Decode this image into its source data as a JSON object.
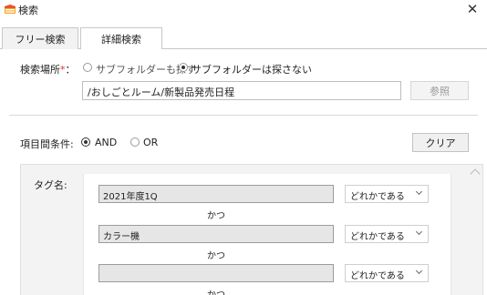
{
  "window": {
    "title": "検索",
    "close_glyph": "✕"
  },
  "tabs": [
    {
      "label": "フリー検索"
    },
    {
      "label": "詳細検索"
    }
  ],
  "search_location": {
    "label": "検索場所",
    "required_mark": "*",
    "colon": "：",
    "option_include": "サブフォルダーも探す",
    "option_exclude": "サブフォルダーは探さない",
    "selected": "exclude",
    "path_value": "/おしごとルーム/新製品発売日程",
    "browse_label": "参照"
  },
  "condition": {
    "label": "項目間条件:",
    "option_and": "AND",
    "option_or": "OR",
    "selected": "AND",
    "clear_label": "クリア"
  },
  "tags": {
    "label": "タグ名:",
    "rows": [
      {
        "value": "2021年度1Q",
        "match": "どれかである"
      },
      {
        "value": "カラー機",
        "match": "どれかである"
      },
      {
        "value": "",
        "match": "どれかである"
      }
    ],
    "connector": "かつ"
  },
  "colors": {
    "accent_red": "#e0303a",
    "input_gray": "#e6e6e6",
    "tag_panel": "#f3f3f3"
  }
}
